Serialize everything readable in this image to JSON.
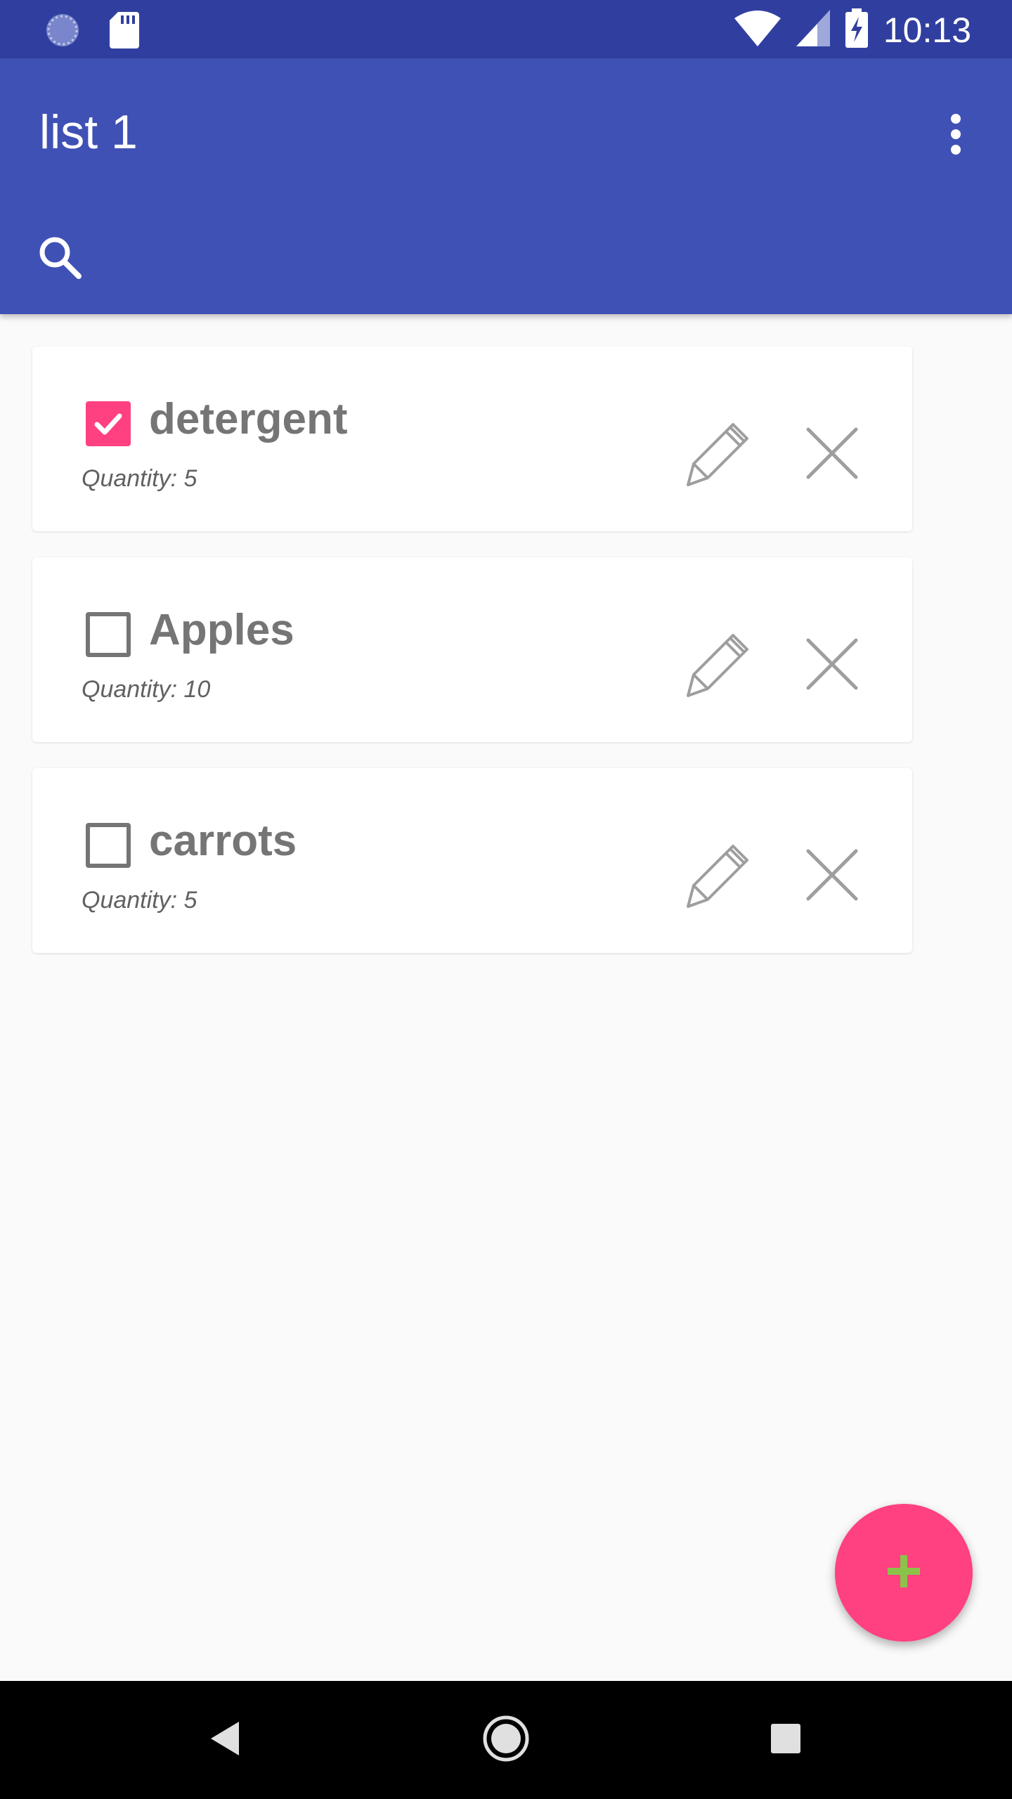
{
  "status_bar": {
    "time": "10:13",
    "icons": [
      "sync-icon",
      "sd-card-icon",
      "wifi-icon",
      "signal-icon",
      "battery-charging-icon"
    ]
  },
  "app_bar": {
    "title": "list 1",
    "icons": [
      "overflow-menu-icon",
      "search-icon"
    ]
  },
  "items": [
    {
      "name": "detergent",
      "quantity_text": "Quantity: 5",
      "checked": true
    },
    {
      "name": "Apples",
      "quantity_text": "Quantity: 10",
      "checked": false
    },
    {
      "name": "carrots",
      "quantity_text": "Quantity: 5",
      "checked": false
    }
  ],
  "item_action_icons": [
    "pencil-icon",
    "close-icon"
  ],
  "fab": {
    "icon": "plus-icon"
  },
  "nav_bar": {
    "icons": [
      "back-icon",
      "home-icon",
      "recents-icon"
    ]
  },
  "colors": {
    "primary": "#3f51b5",
    "primary_dark": "#303f9f",
    "accent": "#ff4081",
    "fab_plus": "#8bc34a"
  }
}
